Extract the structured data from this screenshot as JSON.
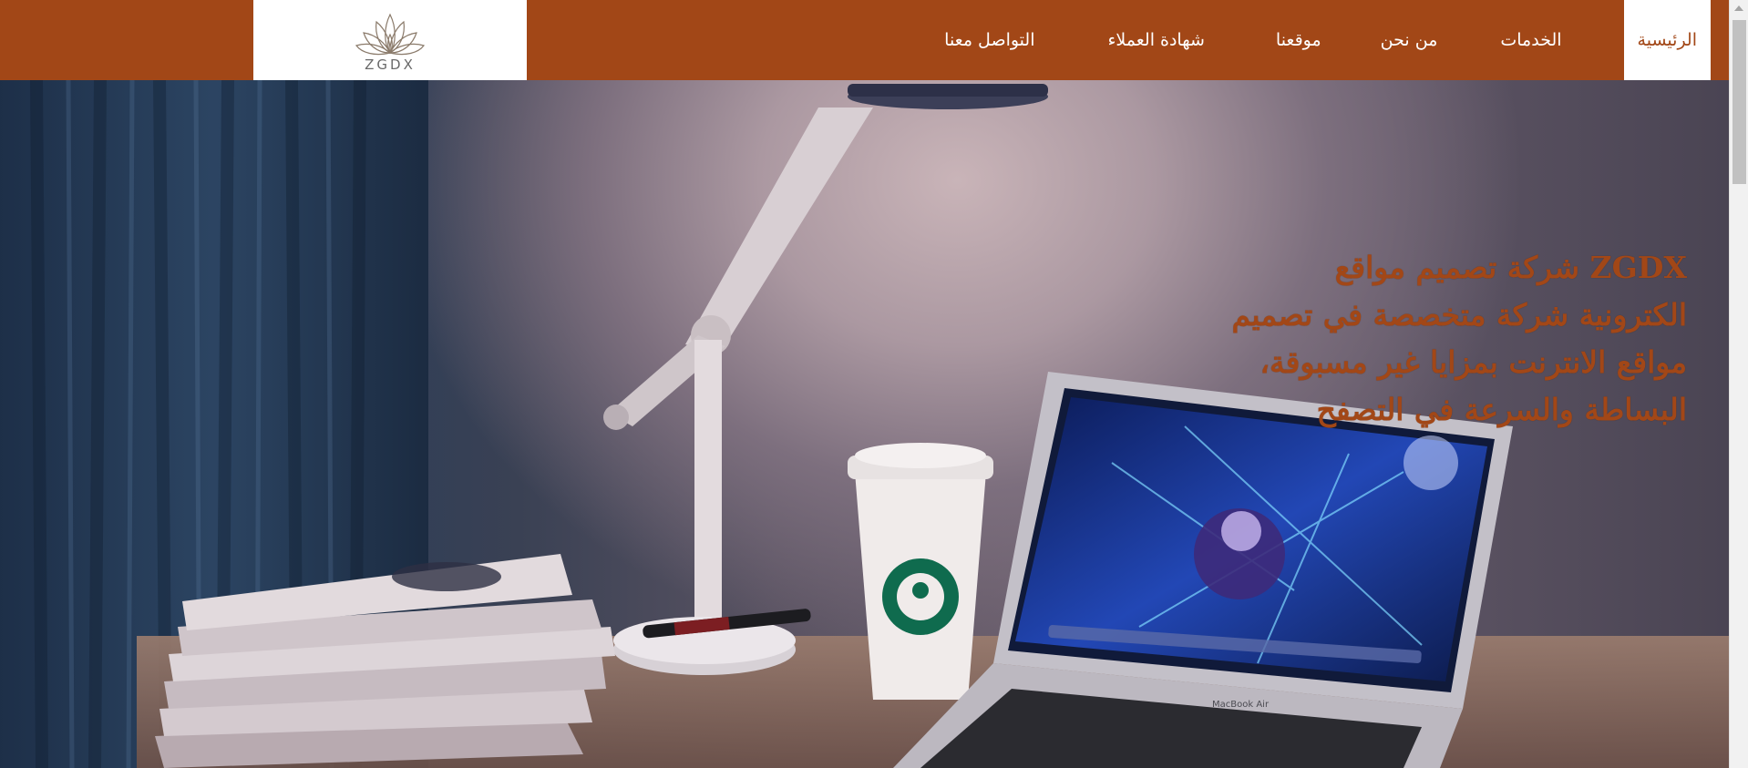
{
  "brand": {
    "name": "ZGDX",
    "accent_color": "#a24717",
    "logo_icon": "lotus-icon"
  },
  "nav": {
    "items": [
      {
        "label": "الرئيسية",
        "active": true
      },
      {
        "label": "الخدمات"
      },
      {
        "label": "من نحن"
      },
      {
        "label": "موقعنا"
      },
      {
        "label": "شهادة العملاء"
      },
      {
        "label": "التواصل معنا"
      }
    ]
  },
  "hero": {
    "headline": "ZGDX شركة تصميم مواقع الكترونية شركة متخصصة في تصميم مواقع الانترنت بمزايا غير مسبوقة، البساطة والسرعة في التصفح",
    "laptop_label": "MacBook Air"
  }
}
